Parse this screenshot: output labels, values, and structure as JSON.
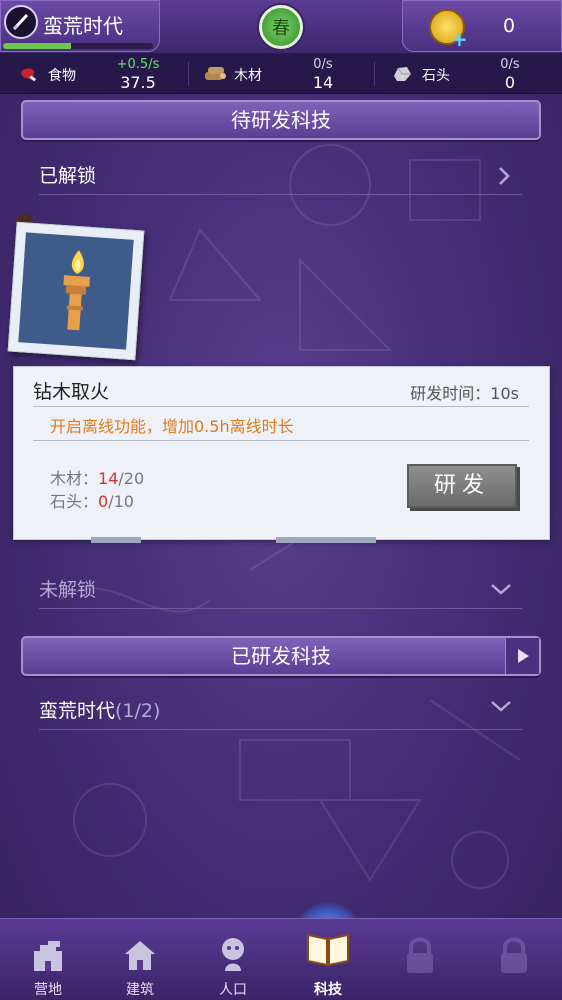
{
  "header": {
    "era_title": "蛮荒时代",
    "era_progress": 0.45,
    "season_label": "春",
    "coin_value": "0",
    "coin_plus": "+"
  },
  "resources": [
    {
      "label": "食物",
      "rate": "+0.5/s",
      "value": "37.5",
      "rate_color": "#69e06a"
    },
    {
      "label": "木材",
      "rate": "0/s",
      "value": "14"
    },
    {
      "label": "石头",
      "rate": "0/s",
      "value": "0"
    }
  ],
  "pending_section": {
    "title": "待研发科技",
    "unlocked_label": "已解锁",
    "locked_label": "未解锁"
  },
  "tech_card": {
    "name": "钻木取火",
    "time_label": "研发时间：10s",
    "description": "开启离线功能，增加0.5h离线时长",
    "costs": [
      {
        "label": "木材：",
        "have": "14",
        "need": "/20"
      },
      {
        "label": "石头：",
        "have": "0",
        "need": "/10"
      }
    ],
    "button_label": "研发"
  },
  "researched_section": {
    "title": "已研发科技",
    "era_label": "蛮荒时代",
    "era_count": "(1/2)"
  },
  "bottom_nav": [
    {
      "label": "营地",
      "icon": "camp-icon"
    },
    {
      "label": "建筑",
      "icon": "house-icon"
    },
    {
      "label": "人口",
      "icon": "person-icon"
    },
    {
      "label": "科技",
      "icon": "book-icon",
      "active": true
    },
    {
      "label": "",
      "icon": "lock-icon"
    },
    {
      "label": "",
      "icon": "lock-icon"
    }
  ]
}
